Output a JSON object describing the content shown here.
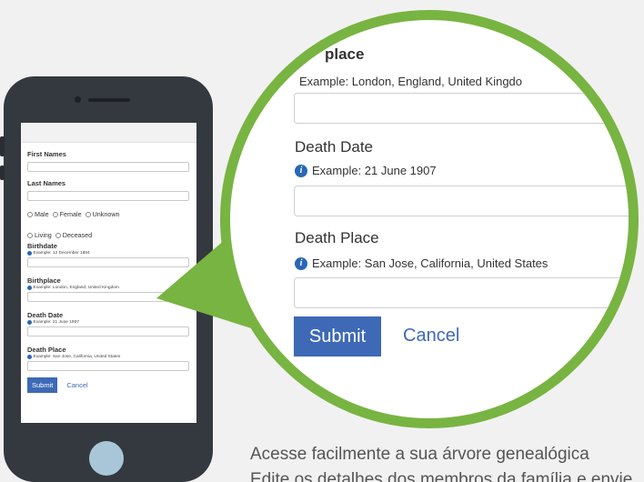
{
  "phone": {
    "form": {
      "first_names_label": "First Names",
      "last_names_label": "Last Names",
      "gender_options": [
        "Male",
        "Female",
        "Unknown"
      ],
      "status_options": [
        "Living",
        "Deceased"
      ],
      "birthdate_label": "Birthdate",
      "birthdate_hint": "Example: 12 December 1884",
      "birthplace_label": "Birthplace",
      "birthplace_hint": "Example: London, England, United Kingdom",
      "death_date_label": "Death Date",
      "death_date_hint": "Example: 21 June 1907",
      "death_place_label": "Death Place",
      "death_place_hint": "Example: San Jose, California, United States",
      "submit_label": "Submit",
      "cancel_label": "Cancel"
    }
  },
  "zoom": {
    "birthplace_label_partial": "place",
    "birthplace_hint_partial": "Example: London, England, United Kingdo",
    "death_date_label": "Death Date",
    "death_date_hint": "Example: 21 June 1907",
    "death_place_label": "Death Place",
    "death_place_hint": "Example: San Jose, California, United States",
    "submit_label": "Submit",
    "cancel_label": "Cancel"
  },
  "caption": {
    "line1": "Acesse facilmente a sua árvore genealógica",
    "line2": "Edite os detalhes dos membros da família e envie"
  },
  "colors": {
    "accent_green": "#78b441",
    "button_blue": "#3d69b6",
    "info_blue": "#2a67b5",
    "phone_body": "#34383f"
  }
}
